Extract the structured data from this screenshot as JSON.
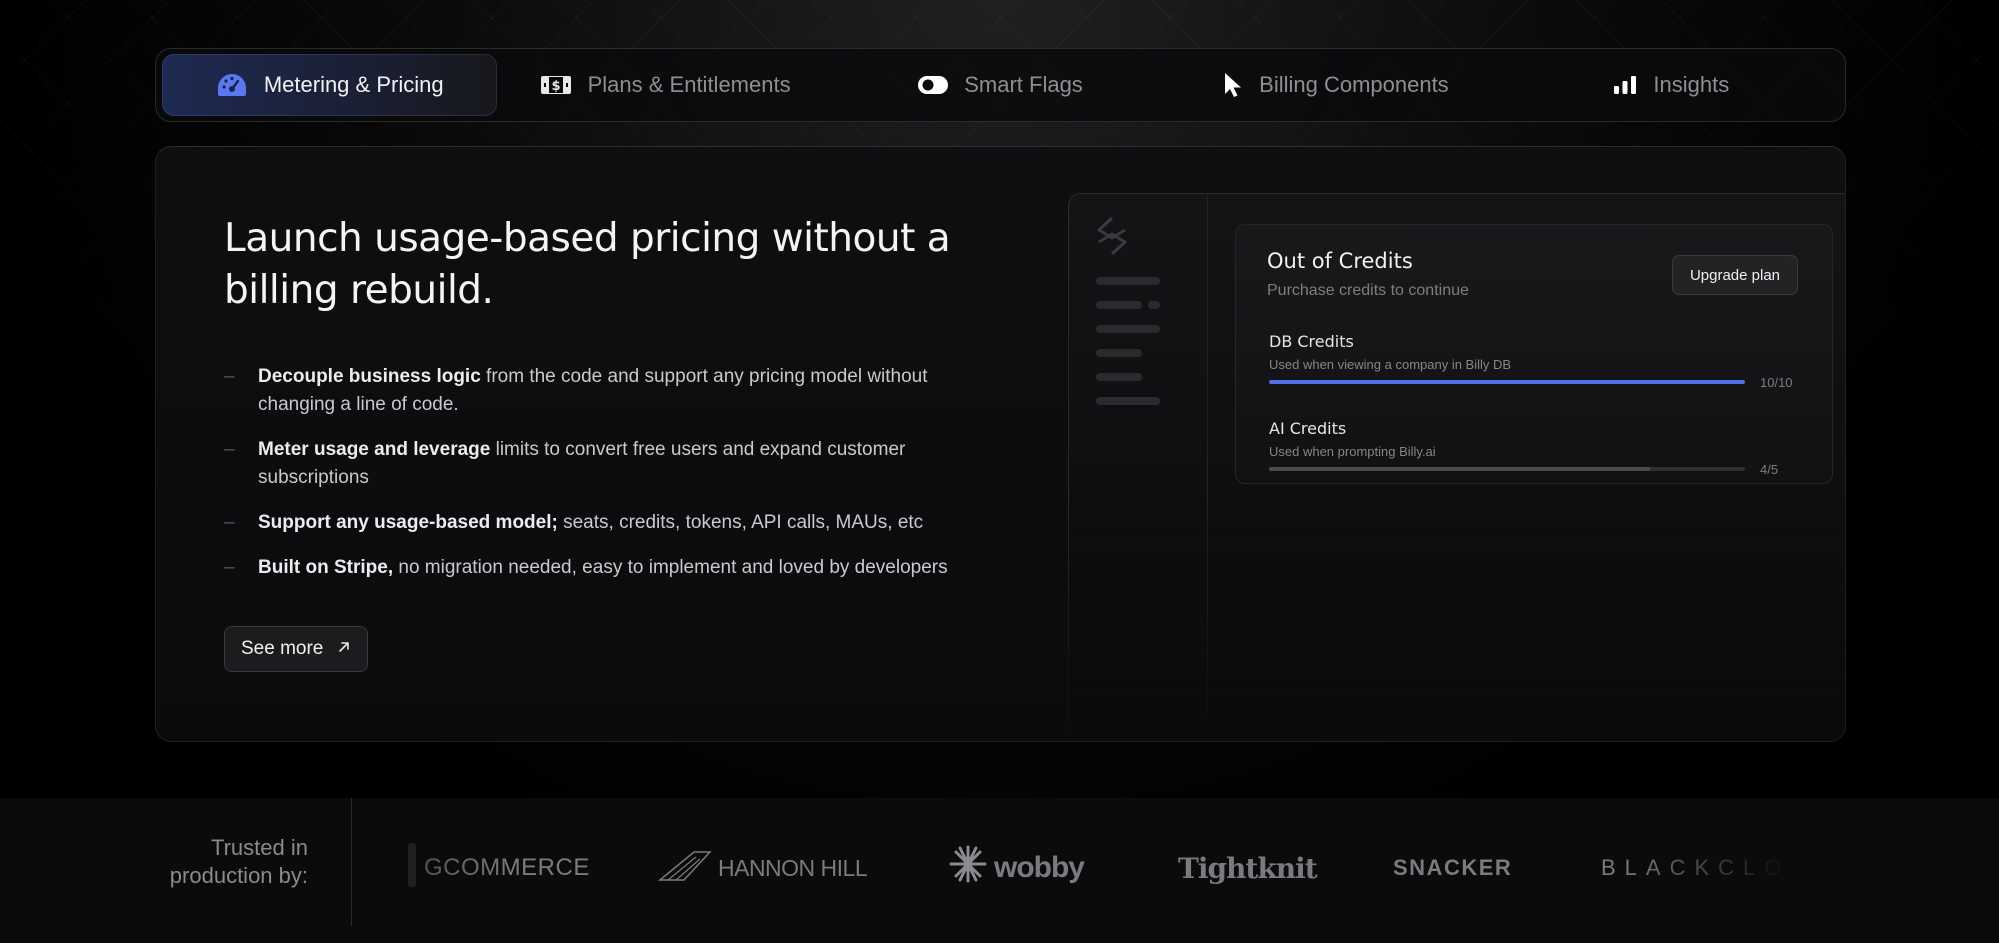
{
  "colors": {
    "accent": "#4f6fe8",
    "accent_bright": "#5a78f0",
    "background": "#000000",
    "panel": "#0f0f11"
  },
  "tabs": [
    {
      "label": "Metering & Pricing",
      "icon": "speedometer-icon",
      "active": true
    },
    {
      "label": "Plans & Entitlements",
      "icon": "ticket-dollar-icon",
      "active": false
    },
    {
      "label": "Smart Flags",
      "icon": "toggle-icon",
      "active": false
    },
    {
      "label": "Billing Components",
      "icon": "cursor-pointer-icon",
      "active": false
    },
    {
      "label": "Insights",
      "icon": "bar-chart-icon",
      "active": false
    }
  ],
  "main": {
    "headline": "Launch usage-based pricing without a billing rebuild.",
    "features": [
      {
        "bold": "Decouple business logic",
        "text": " from the code and support any pricing model without changing a line of code."
      },
      {
        "bold": "Meter usage and leverage",
        "text": " limits to convert free users and expand customer subscriptions"
      },
      {
        "bold": "Support any usage-based model;",
        "text": " seats, credits, tokens, API calls, MAUs, etc"
      },
      {
        "bold": "Built on Stripe,",
        "text": " no migration needed, easy to implement and loved by developers"
      }
    ],
    "dash": "–",
    "see_more_label": "See more",
    "see_more_icon": "arrow-up-right-icon"
  },
  "mock": {
    "logo_icon": "schematic-logo-icon",
    "panel": {
      "title": "Out of Credits",
      "subtitle": "Purchase credits to continue",
      "upgrade_label": "Upgrade plan"
    },
    "credits": [
      {
        "name": "DB Credits",
        "desc": "Used when viewing a company in Billy DB",
        "count": "10/10",
        "used": 10,
        "total": 10,
        "color": "#4f6fe8"
      },
      {
        "name": "AI Credits",
        "desc": "Used when prompting Billy.ai",
        "count": "4/5",
        "used": 4,
        "total": 5,
        "color": "#4a4a50"
      }
    ]
  },
  "trusted": {
    "label_line1": "Trusted in",
    "label_line2": "production by:",
    "logos": [
      {
        "name": "GCOMMERCE",
        "icon": "gcommerce-logo-icon"
      },
      {
        "name": "HANNON HILL",
        "icon": "hannon-hill-logo-icon"
      },
      {
        "name": "wobby",
        "icon": "wobby-logo-icon"
      },
      {
        "name": "Tightknit",
        "icon": ""
      },
      {
        "name": "SNACKER",
        "icon": ""
      },
      {
        "name": "BLACKCLO",
        "icon": ""
      }
    ]
  }
}
